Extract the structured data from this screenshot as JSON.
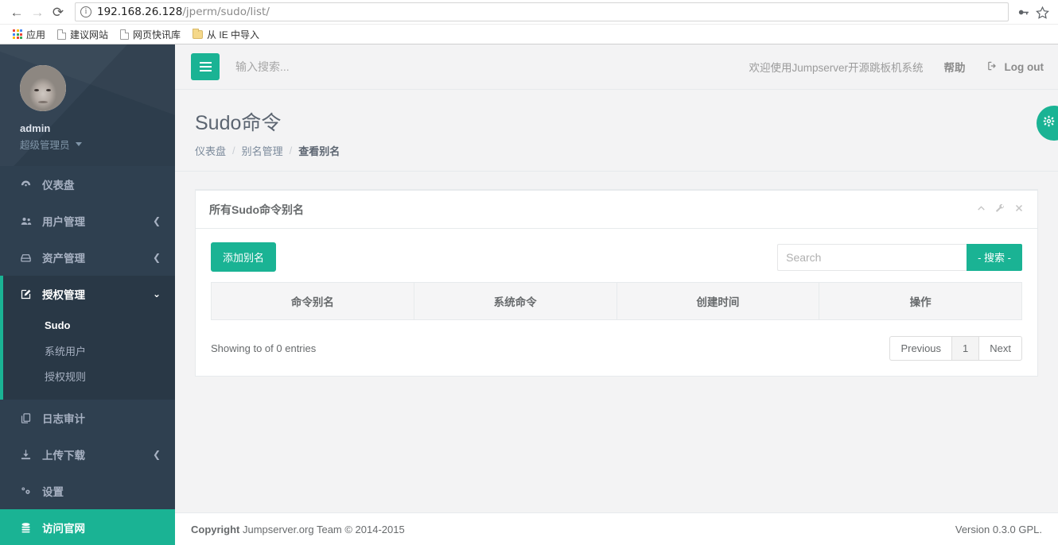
{
  "browser": {
    "back_icon": "←",
    "forward_icon": "→",
    "reload_icon": "⟳",
    "url_host": "192.168.26.128",
    "url_path": "/jperm/sudo/list/",
    "key_icon": "key-icon",
    "star_icon": "☆",
    "bookmarks": [
      {
        "label": "应用",
        "icon": "apps-grid-icon"
      },
      {
        "label": "建议网站",
        "icon": "document-icon"
      },
      {
        "label": "网页快讯库",
        "icon": "document-icon"
      },
      {
        "label": "从 IE 中导入",
        "icon": "folder-icon"
      }
    ]
  },
  "sidebar": {
    "username": "admin",
    "role": "超级管理员",
    "avatar_name": "user-avatar",
    "items": [
      {
        "label": "仪表盘",
        "icon": "dashboard-icon",
        "glyph": "◕",
        "arrow": ""
      },
      {
        "label": "用户管理",
        "icon": "users-icon",
        "glyph": "👥",
        "arrow": "❮"
      },
      {
        "label": "资产管理",
        "icon": "assets-icon",
        "glyph": "⌂",
        "arrow": "❮"
      },
      {
        "label": "授权管理",
        "icon": "edit-icon",
        "glyph": "✎",
        "arrow": "⌄"
      },
      {
        "label": "日志审计",
        "icon": "log-icon",
        "glyph": "❐",
        "arrow": ""
      },
      {
        "label": "上传下载",
        "icon": "download-icon",
        "glyph": "⤓",
        "arrow": "❮"
      },
      {
        "label": "设置",
        "icon": "gear-icon",
        "glyph": "✺",
        "arrow": ""
      },
      {
        "label": "访问官网",
        "icon": "database-icon",
        "glyph": "☰",
        "arrow": ""
      }
    ],
    "submenu": [
      {
        "label": "Sudo",
        "active": true
      },
      {
        "label": "系统用户",
        "active": false
      },
      {
        "label": "授权规则",
        "active": false
      }
    ]
  },
  "topnav": {
    "hamburger_icon": "hamburger-icon",
    "search_placeholder": "输入搜索...",
    "search_value": "",
    "welcome": "欢迎使用Jumpserver开源跳板机系统",
    "help": "帮助",
    "logout": "Log out",
    "logout_icon": "logout-icon"
  },
  "page": {
    "title": "Sudo命令",
    "breadcrumb": [
      {
        "label": "仪表盘",
        "current": false
      },
      {
        "label": "别名管理",
        "current": false
      },
      {
        "label": "查看别名",
        "current": true
      }
    ],
    "breadcrumb_sep": "/",
    "fab_icon": "gear-icon"
  },
  "panel": {
    "title": "所有Sudo命令别名",
    "tools": [
      {
        "icon": "chevron-up-icon",
        "glyph": "⌃"
      },
      {
        "icon": "wrench-icon",
        "glyph": "🔧"
      },
      {
        "icon": "close-icon",
        "glyph": "✕"
      }
    ],
    "add_button": "添加别名",
    "search_placeholder": "Search",
    "search_value": "",
    "search_button": "- 搜索 -",
    "table": {
      "headers": [
        "命令别名",
        "系统命令",
        "创建时间",
        "操作"
      ],
      "rows": []
    },
    "showing_info": "Showing to of 0 entries",
    "pagination": [
      {
        "label": "Previous",
        "active": false
      },
      {
        "label": "1",
        "active": true
      },
      {
        "label": "Next",
        "active": false
      }
    ]
  },
  "footer": {
    "copyright_bold": "Copyright",
    "copyright_rest": " Jumpserver.org Team © 2014-2015",
    "version": "Version 0.3.0 GPL."
  },
  "colors": {
    "accent_green": "#1ab394",
    "sidebar_bg": "#2f4050",
    "sidebar_active_bg": "#293846",
    "page_bg": "#f3f3f4"
  }
}
